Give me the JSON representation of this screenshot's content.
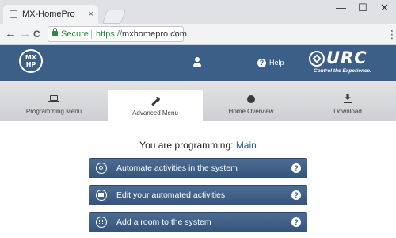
{
  "browser": {
    "tab_title": "MX-HomePro Editor",
    "tab_close": "×",
    "window_controls": {
      "minimize": "—",
      "maximize": "☐",
      "close": "✕"
    },
    "nav": {
      "back": "←",
      "forward": "→",
      "reload": "C"
    },
    "secure_label": "Secure",
    "url_protocol": "https://",
    "url_host": "mxhomepro.com",
    "bookmark_icon": "☆",
    "menu_icon": "⋮"
  },
  "header": {
    "logo_line1": "MX",
    "logo_line2": "HP",
    "help_label": "Help",
    "brand_word": "URC",
    "brand_tagline": "Control the Experience."
  },
  "tabs": [
    {
      "label": "Programming Menu",
      "icon": "laptop-icon"
    },
    {
      "label": "Advanced Menu",
      "icon": "wrench-icon",
      "active": true
    },
    {
      "label": "Home Overview",
      "icon": "globe-icon"
    },
    {
      "label": "Download",
      "icon": "download-icon"
    }
  ],
  "content": {
    "heading_prefix": "You are programming:",
    "heading_mode": "Main",
    "actions": [
      {
        "label": "Automate activities in the system",
        "icon": "target-icon",
        "help": "?"
      },
      {
        "label": "Edit your automated activities",
        "icon": "list-icon",
        "help": "?"
      },
      {
        "label": "Add a room to the system",
        "icon": "room-icon",
        "help": "?"
      }
    ]
  },
  "colors": {
    "header_bg": "#3c5f88",
    "button_bg": "#3f6188",
    "accent_text": "#2f5e8c",
    "secure_green": "#2e8b3c"
  }
}
